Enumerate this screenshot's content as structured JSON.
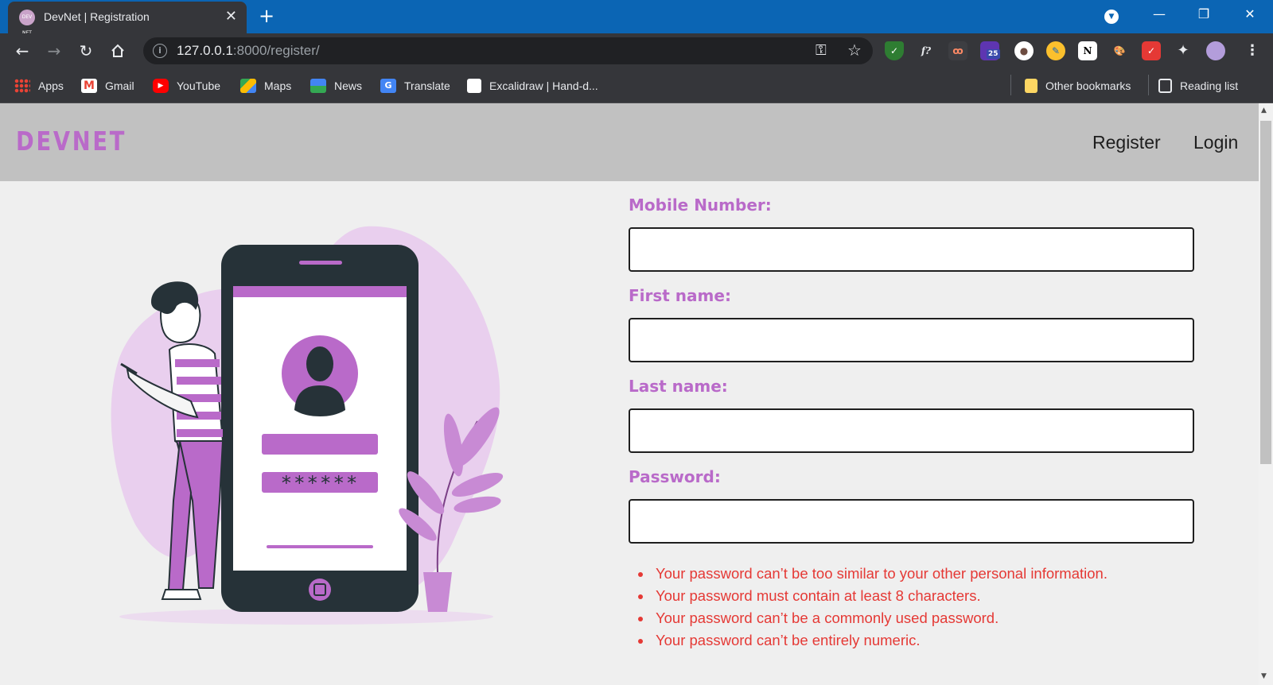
{
  "browser": {
    "tab_title": "DevNet | Registration",
    "tab_favicon_text": "DEV NET",
    "tab_close": "✕",
    "new_tab": "+",
    "window_minimize": "—",
    "window_restore": "❐",
    "window_close": "✕",
    "url_host": "127.0.0.1",
    "url_rest": ":8000/register/",
    "extension_badge": "25",
    "bookmarks": [
      {
        "label": "Apps",
        "icon": "apps-grid-icon"
      },
      {
        "label": "Gmail",
        "icon": "gmail-icon"
      },
      {
        "label": "YouTube",
        "icon": "youtube-icon"
      },
      {
        "label": "Maps",
        "icon": "maps-icon"
      },
      {
        "label": "News",
        "icon": "news-icon"
      },
      {
        "label": "Translate",
        "icon": "translate-icon"
      },
      {
        "label": "Excalidraw | Hand-d...",
        "icon": "excalidraw-icon"
      }
    ],
    "other_bookmarks": "Other bookmarks",
    "reading_list": "Reading list"
  },
  "site": {
    "logo": "DEVNET",
    "nav": {
      "register": "Register",
      "login": "Login"
    },
    "brand_color": "#b96ac9"
  },
  "form": {
    "fields": [
      {
        "label": "Mobile Number:",
        "value": "",
        "placeholder": ""
      },
      {
        "label": "First name:",
        "value": "",
        "placeholder": ""
      },
      {
        "label": "Last name:",
        "value": "",
        "placeholder": ""
      },
      {
        "label": "Password:",
        "value": "",
        "placeholder": ""
      }
    ],
    "password_help": [
      "Your password can’t be too similar to your other personal information.",
      "Your password must contain at least 8 characters.",
      "Your password can’t be a commonly used password.",
      "Your password can’t be entirely numeric."
    ],
    "help_color": "#e53935"
  },
  "illustration": {
    "password_mask": "******"
  }
}
